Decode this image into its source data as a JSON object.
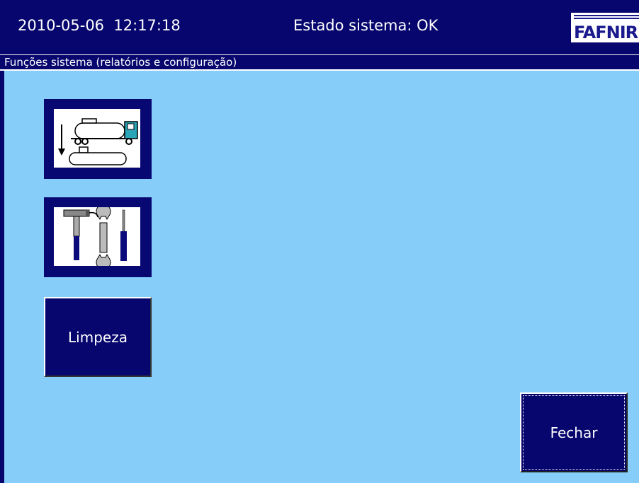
{
  "header": {
    "datetime": "2010-05-06  12:17:18",
    "status": "Estado sistema: OK",
    "logo_text": "FAFNIR"
  },
  "subheader": {
    "title": "Funções sistema (relatórios e configuração)"
  },
  "buttons": {
    "delivery_icon": "tanker-delivery-icon",
    "tools_icon": "tools-icon",
    "cleaning_label": "Limpeza",
    "close_label": "Fechar"
  },
  "colors": {
    "background": "#87cdf9",
    "bar": "#06066e",
    "button": "#06066e",
    "tanker_cab": "#2aa6b8",
    "tool_handle": "#0a0a7a"
  }
}
